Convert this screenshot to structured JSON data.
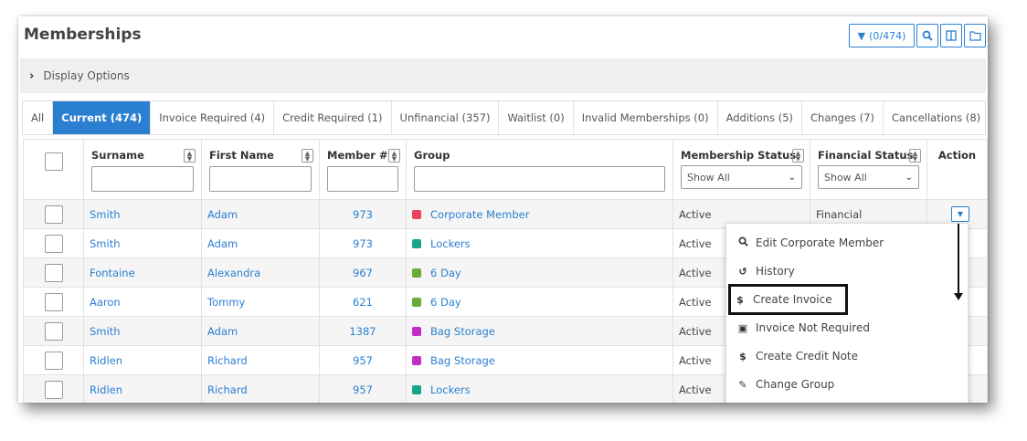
{
  "page": {
    "title": "Memberships",
    "count_button": "(0/474)",
    "display_options": "Display Options"
  },
  "tabs": [
    {
      "label": "All",
      "active": false
    },
    {
      "label": "Current (474)",
      "active": true
    },
    {
      "label": "Invoice Required (4)",
      "active": false
    },
    {
      "label": "Credit Required (1)",
      "active": false
    },
    {
      "label": "Unfinancial (357)",
      "active": false
    },
    {
      "label": "Waitlist (0)",
      "active": false
    },
    {
      "label": "Invalid Memberships (0)",
      "active": false
    },
    {
      "label": "Additions (5)",
      "active": false
    },
    {
      "label": "Changes (7)",
      "active": false
    },
    {
      "label": "Cancellations (8)",
      "active": false
    }
  ],
  "columns": {
    "surname": "Surname",
    "first_name": "First Name",
    "member_num": "Member #",
    "group": "Group",
    "membership_status": "Membership Status",
    "financial_status": "Financial Status",
    "action": "Action",
    "show_all": "Show All"
  },
  "rows": [
    {
      "surname": "Smith",
      "first_name": "Adam",
      "member": "973",
      "group": "Corporate Member",
      "group_color": "#e8455e",
      "status": "Active",
      "financial": "Financial"
    },
    {
      "surname": "Smith",
      "first_name": "Adam",
      "member": "973",
      "group": "Lockers",
      "group_color": "#17a58c",
      "status": "Active",
      "financial": ""
    },
    {
      "surname": "Fontaine",
      "first_name": "Alexandra",
      "member": "967",
      "group": "6 Day",
      "group_color": "#6aaa3a",
      "status": "Active",
      "financial": ""
    },
    {
      "surname": "Aaron",
      "first_name": "Tommy",
      "member": "621",
      "group": "6 Day",
      "group_color": "#6aaa3a",
      "status": "Active",
      "financial": ""
    },
    {
      "surname": "Smith",
      "first_name": "Adam",
      "member": "1387",
      "group": "Bag Storage",
      "group_color": "#c22ec2",
      "status": "Active",
      "financial": ""
    },
    {
      "surname": "Ridlen",
      "first_name": "Richard",
      "member": "957",
      "group": "Bag Storage",
      "group_color": "#c22ec2",
      "status": "Active",
      "financial": ""
    },
    {
      "surname": "Ridlen",
      "first_name": "Richard",
      "member": "957",
      "group": "Lockers",
      "group_color": "#17a58c",
      "status": "Active",
      "financial": ""
    }
  ],
  "menu": [
    {
      "label": "Edit Corporate Member",
      "icon": "search-icon",
      "glyph": "🔍︎"
    },
    {
      "label": "History",
      "icon": "history-icon",
      "glyph": "↺"
    },
    {
      "label": "Create Invoice",
      "icon": "dollar-icon",
      "glyph": "$"
    },
    {
      "label": "Invoice Not Required",
      "icon": "banknote-icon",
      "glyph": "▣"
    },
    {
      "label": "Create Credit Note",
      "icon": "dollar-icon",
      "glyph": "$"
    },
    {
      "label": "Change Group",
      "icon": "pencil-icon",
      "glyph": "✎"
    }
  ],
  "colors": {
    "accent": "#2a7fd0",
    "highlight_border": "#111111"
  }
}
